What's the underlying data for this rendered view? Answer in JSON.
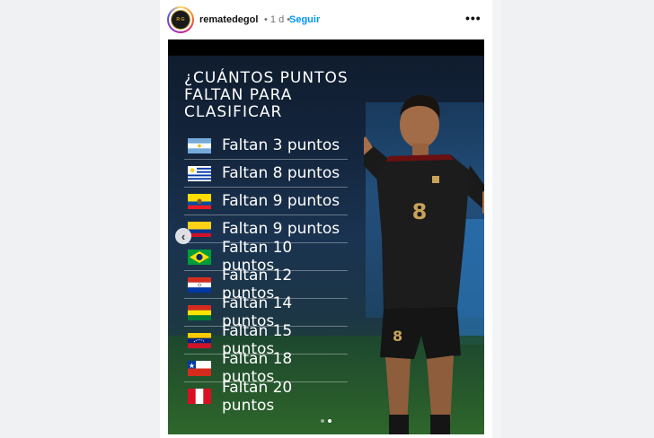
{
  "post": {
    "username": "rematedegol",
    "time": "• 1 d •",
    "follow_label": "Seguir",
    "more_icon": "more-horizontal-icon",
    "avatar_text": "REMATE DE GOL"
  },
  "graphic": {
    "title_lines": [
      "¿CUÁNTOS PUNTOS",
      "FALTAN PARA",
      "CLASIFICAR"
    ],
    "rows": [
      {
        "country": "Argentina",
        "label": "Faltan 3 puntos"
      },
      {
        "country": "Uruguay",
        "label": "Faltan 8 puntos"
      },
      {
        "country": "Ecuador",
        "label": "Faltan 9 puntos"
      },
      {
        "country": "Colombia",
        "label": "Faltan 9 puntos"
      },
      {
        "country": "Brasil",
        "label": "Faltan 10 puntos"
      },
      {
        "country": "Paraguay",
        "label": "Faltan 12 puntos"
      },
      {
        "country": "Bolivia",
        "label": "Faltan 14 puntos"
      },
      {
        "country": "Venezuela",
        "label": "Faltan 15 puntos"
      },
      {
        "country": "Chile",
        "label": "Faltan 18 puntos"
      },
      {
        "country": "Perú",
        "label": "Faltan 20 puntos"
      }
    ],
    "jersey_number": "8"
  },
  "carousel": {
    "slide_count": 2,
    "active_index": 1
  },
  "colors": {
    "follow": "#0095f6",
    "background": "#f3f4f6"
  }
}
